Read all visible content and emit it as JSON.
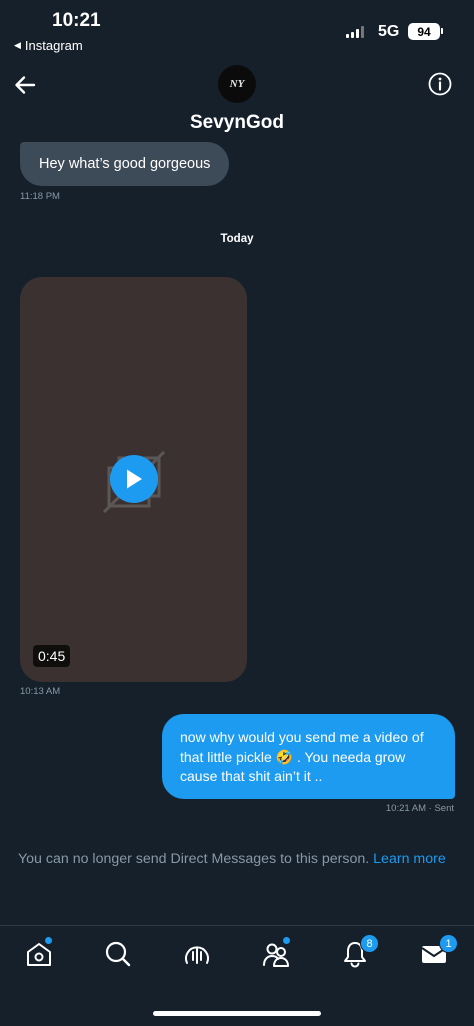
{
  "status_bar": {
    "time": "10:21",
    "back_app": "Instagram",
    "network": "5G",
    "battery": "94"
  },
  "header": {
    "avatar_text": "NY",
    "title": "SevynGod"
  },
  "messages": {
    "incoming_text": "Hey what’s good gorgeous",
    "incoming_time": "11:18 PM",
    "date_divider": "Today",
    "video_duration": "0:45",
    "video_time": "10:13 AM",
    "outgoing_lines": [
      "now why would you send me a video of",
      "that little pickle 🤣 . You needa grow",
      "cause that shit ain’t it .."
    ],
    "outgoing_meta": "10:21 AM · Sent"
  },
  "notice": {
    "text": "You can no longer send Direct Messages to this person.",
    "link": "Learn more"
  },
  "nav": {
    "notifications_count": "8",
    "messages_count": "1"
  },
  "colors": {
    "background": "#15202b",
    "accent": "#1d9bf0",
    "incoming_bubble": "#3d4a57",
    "muted_text": "#8899a6"
  }
}
